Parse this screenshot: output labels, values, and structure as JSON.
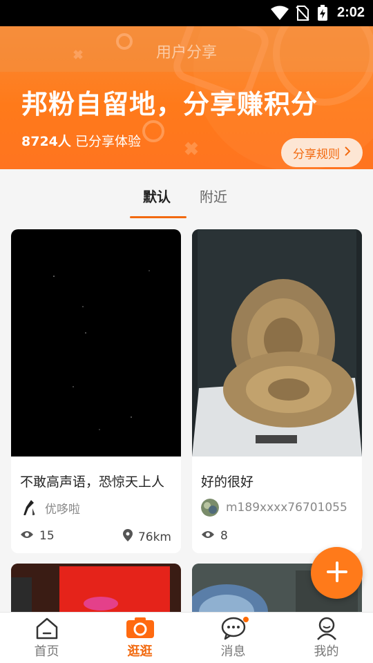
{
  "status_bar": {
    "time": "2:02"
  },
  "banner": {
    "page_title": "用户分享",
    "headline": "邦粉自留地，分享赚积分",
    "shared_count": "8724人",
    "shared_text": "已分享体验",
    "rules_button": "分享规则"
  },
  "tabs": [
    {
      "label": "默认",
      "active": true
    },
    {
      "label": "附近",
      "active": false
    }
  ],
  "cards": [
    {
      "title": "不敢高声语，恐惊天上人",
      "author": "优哆啦",
      "views": "15",
      "distance": "76km"
    },
    {
      "title": "好的很好",
      "author": "m189xxxx76701055",
      "views": "8"
    }
  ],
  "bottom_nav": [
    {
      "label": "首页",
      "icon": "home-icon",
      "active": false
    },
    {
      "label": "逛逛",
      "icon": "camera-icon",
      "active": true
    },
    {
      "label": "消息",
      "icon": "message-icon",
      "active": false,
      "badge": true
    },
    {
      "label": "我的",
      "icon": "profile-icon",
      "active": false
    }
  ],
  "colors": {
    "accent": "#f26a10",
    "banner": "#ff7a1a"
  }
}
